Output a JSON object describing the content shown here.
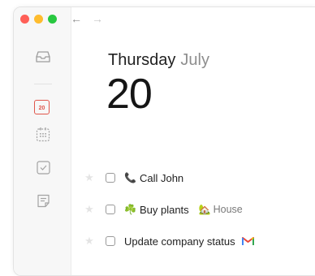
{
  "window": {
    "traffic_lights": [
      "close",
      "minimize",
      "zoom"
    ]
  },
  "sidebar": {
    "items": [
      {
        "name": "inbox",
        "icon": "inbox-icon"
      },
      {
        "name": "today",
        "icon": "calendar-today-icon",
        "badge": "20"
      },
      {
        "name": "upcoming",
        "icon": "calendar-grid-icon"
      },
      {
        "name": "done",
        "icon": "checkbox-icon"
      },
      {
        "name": "notes",
        "icon": "note-icon"
      }
    ]
  },
  "nav": {
    "back": "←",
    "forward": "→"
  },
  "header": {
    "weekday": "Thursday",
    "month": "July",
    "day": "20"
  },
  "tasks": [
    {
      "emoji": "📞",
      "title": "Call John",
      "tag": null
    },
    {
      "emoji": "☘️",
      "title": "Buy plants",
      "tag": {
        "emoji": "🏡",
        "label": "House"
      }
    },
    {
      "emoji": null,
      "title": "Update company status",
      "tag": null,
      "app_icon": "gmail-icon"
    }
  ],
  "colors": {
    "accent": "#e0564b",
    "gmail_red": "#ea4335"
  }
}
